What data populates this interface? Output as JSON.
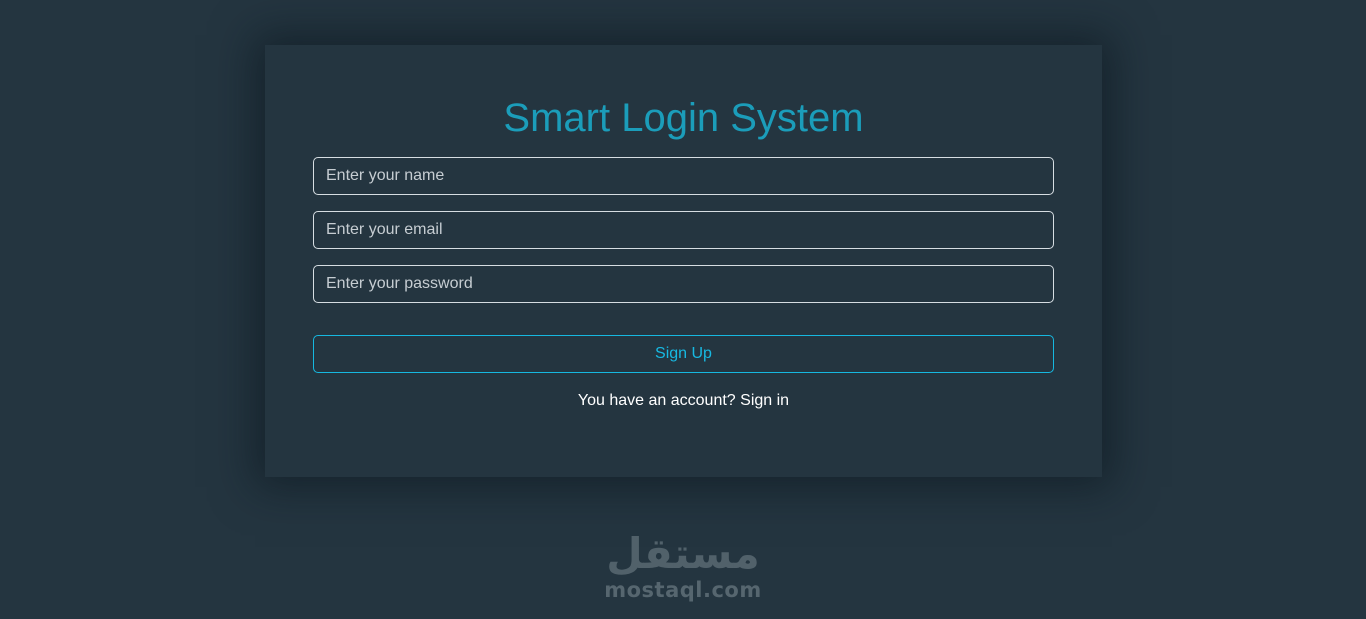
{
  "form": {
    "title": "Smart Login System",
    "name_placeholder": "Enter your name",
    "email_placeholder": "Enter your email",
    "password_placeholder": "Enter your password",
    "signup_label": "Sign Up",
    "account_prompt": "You have an account?",
    "signin_label": "Sign in"
  },
  "watermark": {
    "arabic": "مستقل",
    "latin": "mostaql.com"
  },
  "colors": {
    "background": "#243540",
    "accent": "#17b9e2",
    "title": "#1b9dba"
  }
}
